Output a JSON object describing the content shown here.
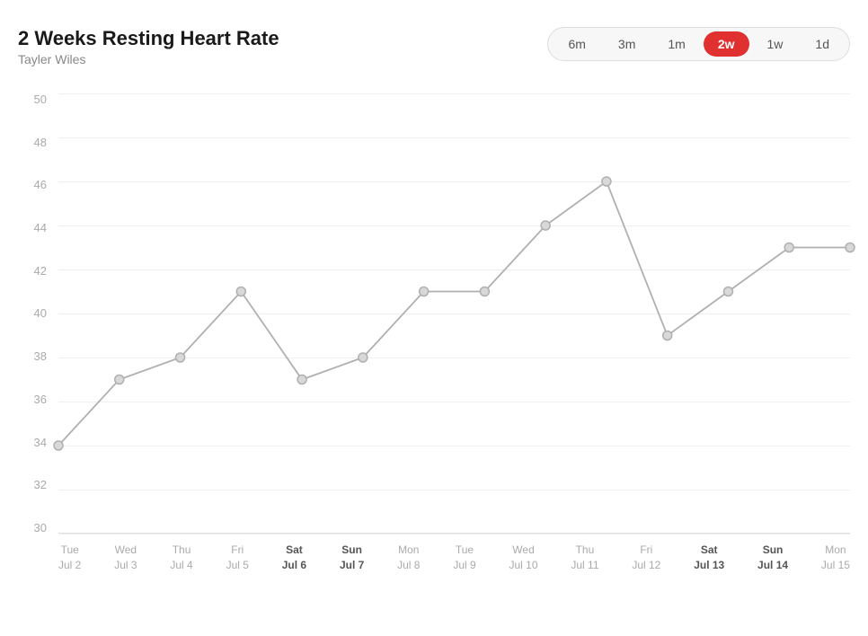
{
  "header": {
    "title": "2 Weeks Resting Heart Rate",
    "subtitle": "Tayler Wiles"
  },
  "timeButtons": [
    {
      "label": "6m",
      "active": false
    },
    {
      "label": "3m",
      "active": false
    },
    {
      "label": "1m",
      "active": false
    },
    {
      "label": "2w",
      "active": true
    },
    {
      "label": "1w",
      "active": false
    },
    {
      "label": "1d",
      "active": false
    }
  ],
  "yAxis": {
    "labels": [
      "50",
      "48",
      "46",
      "44",
      "42",
      "40",
      "38",
      "36",
      "34",
      "32",
      "30"
    ],
    "min": 30,
    "max": 50
  },
  "xLabels": [
    {
      "line1": "Tue",
      "line2": "Jul 2",
      "bold": false
    },
    {
      "line1": "Wed",
      "line2": "Jul 3",
      "bold": false
    },
    {
      "line1": "Thu",
      "line2": "Jul 4",
      "bold": false
    },
    {
      "line1": "Fri",
      "line2": "Jul 5",
      "bold": false
    },
    {
      "line1": "Sat",
      "line2": "Jul 6",
      "bold": true
    },
    {
      "line1": "Sun",
      "line2": "Jul 7",
      "bold": true
    },
    {
      "line1": "Mon",
      "line2": "Jul 8",
      "bold": false
    },
    {
      "line1": "Tue",
      "line2": "Jul 9",
      "bold": false
    },
    {
      "line1": "Wed",
      "line2": "Jul 10",
      "bold": false
    },
    {
      "line1": "Thu",
      "line2": "Jul 11",
      "bold": false
    },
    {
      "line1": "Fri",
      "line2": "Jul 12",
      "bold": false
    },
    {
      "line1": "Sat",
      "line2": "Jul 13",
      "bold": true
    },
    {
      "line1": "Sun",
      "line2": "Jul 14",
      "bold": true
    },
    {
      "line1": "Mon",
      "line2": "Jul 15",
      "bold": false
    }
  ],
  "dataPoints": [
    34,
    37,
    38,
    41,
    37,
    38,
    41,
    41,
    44,
    46,
    39,
    41,
    43,
    43
  ],
  "colors": {
    "activeBtn": "#e03030",
    "line": "#b0b0b0",
    "dot": "#c8c8c8",
    "dotStroke": "#b0b0b0"
  }
}
